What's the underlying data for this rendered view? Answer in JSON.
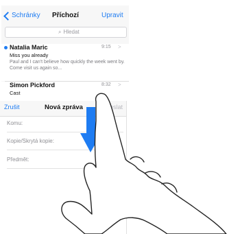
{
  "inbox": {
    "back_label": "Schránky",
    "title": "Příchozí",
    "edit_label": "Upravit",
    "search_placeholder": "Hledat",
    "messages": [
      {
        "sender": "Natalia Maric",
        "time": "9:15",
        "subject": "Miss you already",
        "preview": "Paul and I can't believe how quickly the week went by. Come visit us again so...",
        "unread": true
      },
      {
        "sender": "Simon Pickford",
        "time": "8:32",
        "subject": "Cast",
        "preview": "",
        "unread": false
      }
    ]
  },
  "compose": {
    "cancel_label": "Zrušit",
    "title": "Nová zpráva",
    "send_label": "Odeslat",
    "fields": [
      "Komu:",
      "Kopie/Skrytá kopie:",
      "Předmět:"
    ]
  },
  "colors": {
    "accent": "#1e7cf2",
    "gesture_arrow": "#1e7cf2"
  },
  "icons": [
    "back-chevron-icon",
    "search-icon",
    "unread-dot-icon",
    "row-chevron-icon",
    "swipe-down-arrow-icon",
    "hand-icon"
  ]
}
